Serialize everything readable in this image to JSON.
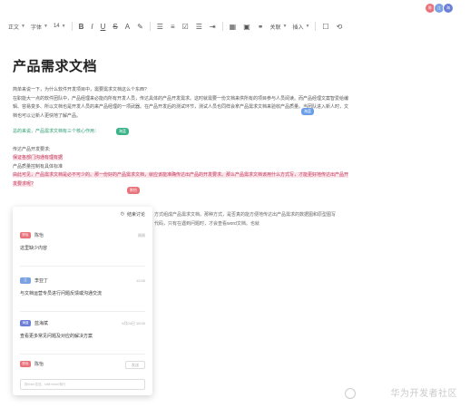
{
  "collaborators": [
    {
      "label": "陈",
      "color": "#e8737b"
    },
    {
      "label": "江",
      "color": "#7aa2e0"
    },
    {
      "label": "海",
      "color": "#6b7fd7"
    }
  ],
  "toolbar": {
    "style_label": "正文",
    "font_label": "字体",
    "size_label": "14",
    "link_label": "关联",
    "insert_label": "插入"
  },
  "doc": {
    "title": "产品需求文档",
    "para1": "简单来说一下，为什么软件开发项目中，需要需求文档这么个东西?\n在职能大一点的软件团队中，产品经理来必能向所有开发人员，传达具体的产品开发需求。这时就需要一份文档来供所有的项目参与人员阅读。而产品经理文案智爱给编辑、容易变多、所以文档也是开发人员的来产品经理的一项武器。在产品开发后的测试环节，测试人员也同样会拿产品需求文档来验收产品质量。当团队进入新人时，文档也可以让新人更快地了解产品。",
    "para2": "总的来说，产品需求文档有三个核心作用：",
    "para3_a": "传达产品开发要求;",
    "para3_b": "保证各部门沟通有理有据",
    "para3_c": "产品质量控制有具体标准",
    "para3_d": "由此可见，产品需求文档是必不可少的。那一份好的产品需求文档，就应该能准确传达出产品的开发要求。那么产品需求文档该用什么方式写，才能更好地传达出产品开发要求呢?",
    "rest": "方式组成产品需求文档。那种方式，是否真的能方便地传达出产品需求的数据图和原型图写代码，只有在遇到问题时，才会查看word文档。也就",
    "tag_haixi": "海蓝",
    "tag_chen": "陈怡",
    "tag_green": "海蓝"
  },
  "comments_panel": {
    "end_discussion": "结束讨论",
    "comments": [
      {
        "tag": "陈怡",
        "tag_color": "#e8737b",
        "name": "陈怡",
        "time": "刚刚",
        "text": "这里缺少内容"
      },
      {
        "tag": "江",
        "tag_color": "#7aa2e0",
        "name": "李亚丁",
        "time": "12:00",
        "text": "与文档运营专员进行问题反馈或沟通交流"
      },
      {
        "tag": "海蓝",
        "tag_color": "#6b7fd7",
        "name": "蓝海斌",
        "time": "9月04日 15:00",
        "text": "查看更多常见问题及对应的解决方案"
      }
    ],
    "reply_tag": "陈怡",
    "reply_name": "陈怡",
    "send_label": "发送",
    "reply_placeholder": "按enter发送，shift+enter换行"
  },
  "watermark": "华为开发者社区"
}
